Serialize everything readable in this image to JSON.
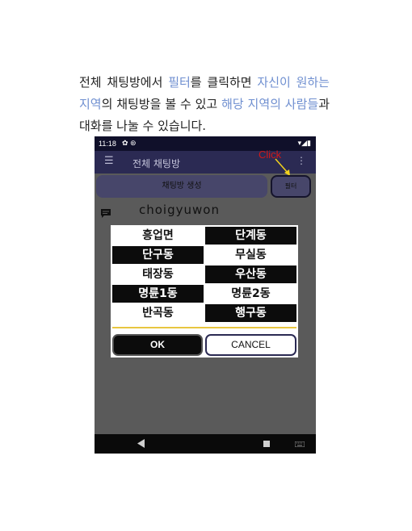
{
  "paragraph": [
    {
      "text": "전체 채팅방에서 ",
      "hl": false
    },
    {
      "text": "필터",
      "hl": true
    },
    {
      "text": "를 클릭하면 ",
      "hl": false
    },
    {
      "text": "자신이 원하는 지역",
      "hl": true
    },
    {
      "text": "의 채팅방을 볼 수 있고 ",
      "hl": false
    },
    {
      "text": "해당 지역의 사람들",
      "hl": true
    },
    {
      "text": "과 대화를 나눌 수 있습니다.",
      "hl": false
    }
  ],
  "status_bar": {
    "time": "11:18"
  },
  "app_bar": {
    "title": "전체 채팅방"
  },
  "annotation": {
    "label": "Click",
    "color": "#d11818"
  },
  "buttons": {
    "create_room": "채팅방 생성",
    "filter": "필터",
    "ok": "OK",
    "cancel": "CANCEL"
  },
  "room": {
    "name": "choigyuwon"
  },
  "regions": [
    {
      "name": "흥업면",
      "selected": false
    },
    {
      "name": "단계동",
      "selected": true
    },
    {
      "name": "단구동",
      "selected": true
    },
    {
      "name": "무실동",
      "selected": false
    },
    {
      "name": "태장동",
      "selected": false
    },
    {
      "name": "우산동",
      "selected": true
    },
    {
      "name": "명륜1동",
      "selected": true
    },
    {
      "name": "명륜2동",
      "selected": false
    },
    {
      "name": "반곡동",
      "selected": false
    },
    {
      "name": "행구동",
      "selected": true
    }
  ],
  "colors": {
    "highlight_text": "#6f8fd0",
    "app_bar": "#2b2a53",
    "divider": "#e8c640"
  }
}
